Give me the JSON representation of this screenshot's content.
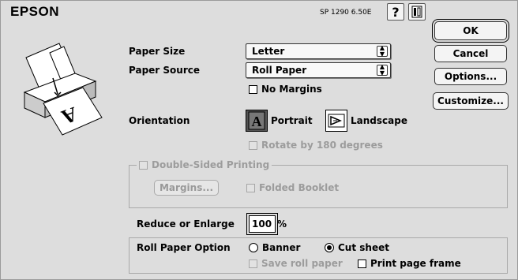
{
  "header": {
    "brand": "EPSON",
    "version": "SP 1290 6.50E",
    "help_icon": "question-mark-icon",
    "utility_icon": "printer-utility-icon"
  },
  "buttons": {
    "ok": "OK",
    "cancel": "Cancel",
    "options": "Options...",
    "customize": "Customize..."
  },
  "paper_size": {
    "label": "Paper Size",
    "value": "Letter"
  },
  "paper_source": {
    "label": "Paper Source",
    "value": "Roll Paper"
  },
  "no_margins": {
    "label": "No Margins",
    "checked": false
  },
  "orientation": {
    "label": "Orientation",
    "portrait": "Portrait",
    "landscape": "Landscape",
    "selected": "Portrait",
    "portrait_glyph": "A"
  },
  "rotate": {
    "label": "Rotate by 180 degrees",
    "enabled": false
  },
  "double_sided": {
    "label": "Double-Sided Printing",
    "enabled": false,
    "margins_button": "Margins...",
    "folded_booklet": "Folded Booklet"
  },
  "reduce_enlarge": {
    "label": "Reduce or Enlarge",
    "value": "100",
    "unit": "%"
  },
  "roll_paper_option": {
    "label": "Roll Paper Option",
    "banner": "Banner",
    "cut_sheet": "Cut sheet",
    "selected": "Cut sheet",
    "save_roll_paper": "Save roll paper",
    "print_page_frame": "Print page frame"
  }
}
